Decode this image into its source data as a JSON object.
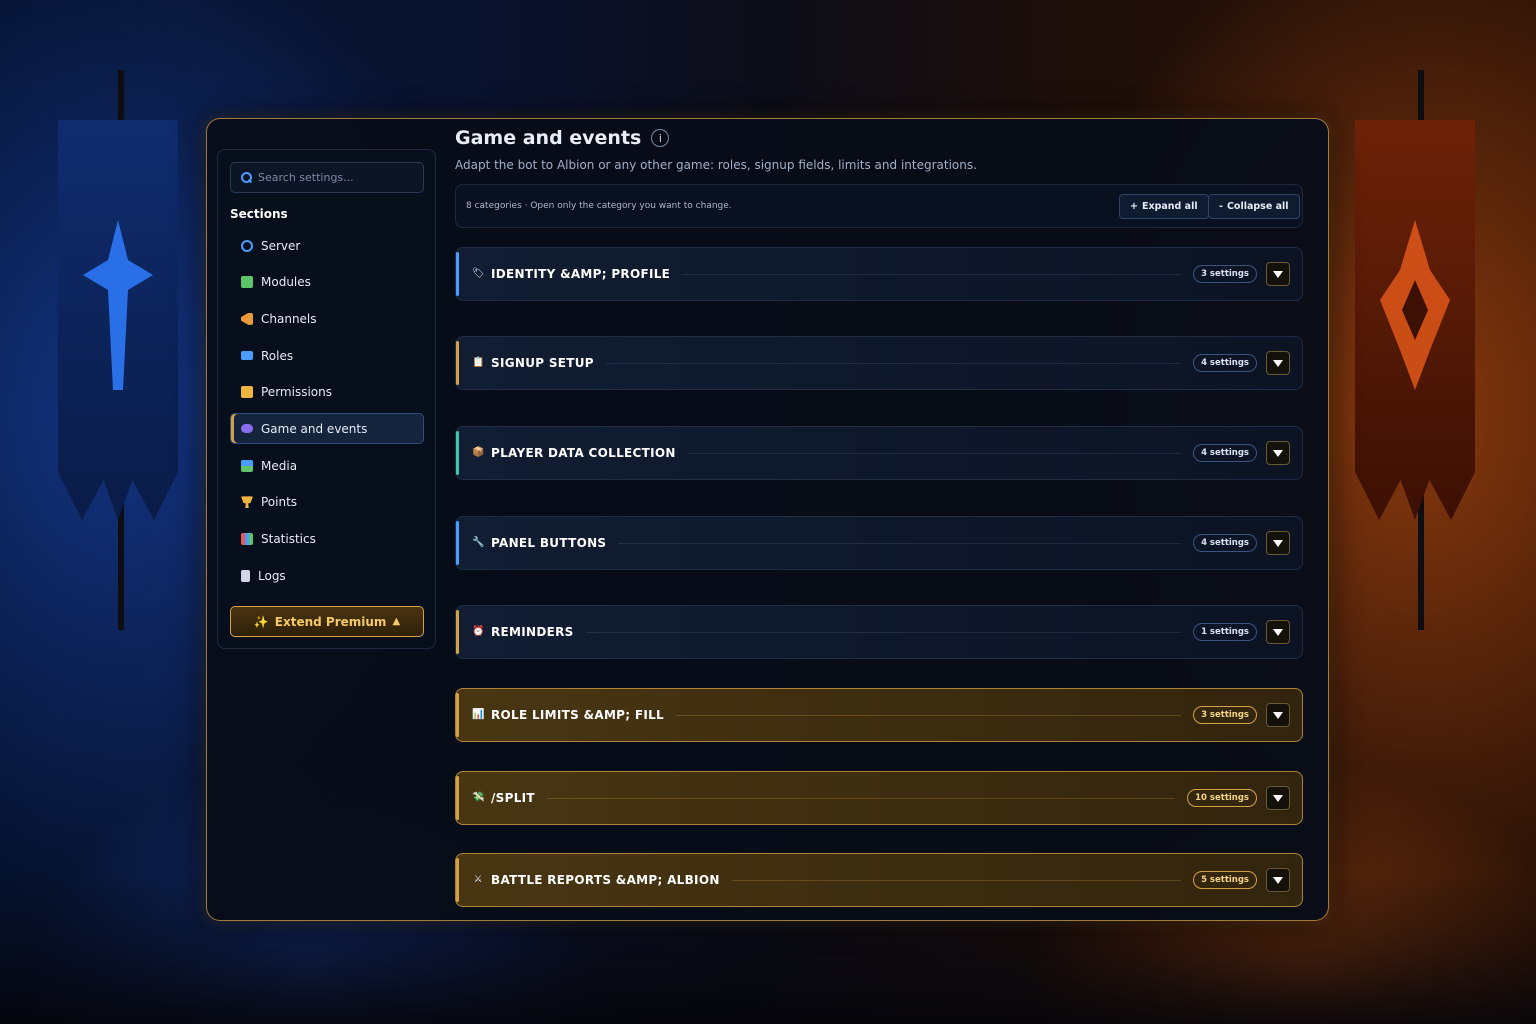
{
  "search": {
    "placeholder": "Search settings..."
  },
  "sidebar": {
    "title": "Sections",
    "items": [
      {
        "label": "Server",
        "icon": "globe-icon",
        "color": "#4b9cff"
      },
      {
        "label": "Modules",
        "icon": "puzzle-icon",
        "color": "#5ec46a"
      },
      {
        "label": "Channels",
        "icon": "megaphone-icon",
        "color": "#e99b3c"
      },
      {
        "label": "Roles",
        "icon": "id-card-icon",
        "color": "#4b9cff"
      },
      {
        "label": "Permissions",
        "icon": "lock-icon",
        "color": "#f0b541"
      },
      {
        "label": "Game and events",
        "icon": "gamepad-icon",
        "color": "#8a6cf0",
        "active": true
      },
      {
        "label": "Media",
        "icon": "picture-icon",
        "color": "#5ec46a"
      },
      {
        "label": "Points",
        "icon": "trophy-icon",
        "color": "#f0b541"
      },
      {
        "label": "Statistics",
        "icon": "bar-chart-icon",
        "color": "#e85a5a"
      },
      {
        "label": "Logs",
        "icon": "scroll-icon",
        "color": "#cfd8e6"
      }
    ],
    "premium_label": "Extend Premium",
    "premium_icons": {
      "left": "✨",
      "right": "▲"
    }
  },
  "header": {
    "title": "Game and events",
    "info_glyph": "i",
    "subtitle": "Adapt the bot to Albion or any other game: roles, signup fields, limits and integrations."
  },
  "toolbar": {
    "summary": "8 categories · Open only the category you want to change.",
    "expand_label": "Expand all",
    "expand_glyph": "+",
    "collapse_label": "Collapse all",
    "collapse_glyph": "-"
  },
  "categories": [
    {
      "title": "IDENTITY &AMP; PROFILE",
      "badge": "3 settings",
      "icon": "tag-icon",
      "glyph": "🏷",
      "accent": "#4b9cff",
      "style": "dark"
    },
    {
      "title": "SIGNUP SETUP",
      "badge": "4 settings",
      "icon": "clipboard-icon",
      "glyph": "📋",
      "accent": "#d6a046",
      "style": "dark"
    },
    {
      "title": "PLAYER DATA COLLECTION",
      "badge": "4 settings",
      "icon": "box-icon",
      "glyph": "📦",
      "accent": "#3ec6a6",
      "style": "dark"
    },
    {
      "title": "PANEL BUTTONS",
      "badge": "4 settings",
      "icon": "wrench-icon",
      "glyph": "🔧",
      "accent": "#4b9cff",
      "style": "dark"
    },
    {
      "title": "REMINDERS",
      "badge": "1 settings",
      "icon": "alarm-clock-icon",
      "glyph": "⏰",
      "accent": "#d6a046",
      "style": "dark"
    },
    {
      "title": "ROLE LIMITS &AMP; FILL",
      "badge": "3 settings",
      "icon": "bar-chart-icon",
      "glyph": "📊",
      "accent": "#d6a046",
      "style": "gold"
    },
    {
      "title": "/SPLIT",
      "badge": "10 settings",
      "icon": "money-icon",
      "glyph": "💸",
      "accent": "#d6a046",
      "style": "gold"
    },
    {
      "title": "BATTLE REPORTS &AMP; ALBION",
      "badge": "5 settings",
      "icon": "crossed-swords-icon",
      "glyph": "⚔",
      "accent": "#d6a046",
      "style": "gold"
    }
  ]
}
